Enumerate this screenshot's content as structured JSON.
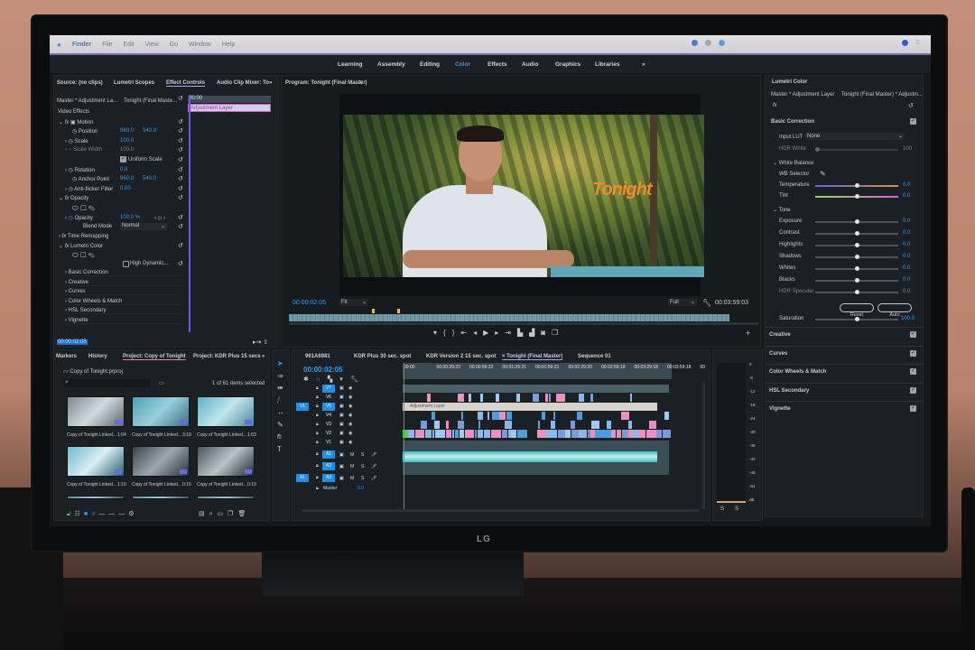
{
  "monitor_brand": "LG",
  "menubar": {
    "items": [
      "Finder",
      "File",
      "Edit",
      "View",
      "Go",
      "Window",
      "Help"
    ]
  },
  "workspaces": {
    "items": [
      "Learning",
      "Assembly",
      "Editing",
      "Color",
      "Effects",
      "Audio",
      "Graphics",
      "Libraries"
    ],
    "active": "Color",
    "more": "»",
    "accent": "#2d9bf0"
  },
  "left_panel": {
    "tabs": [
      "Source: (no clips)",
      "Lumetri Scopes",
      "Effect Controls",
      "Audio Clip Mixer: To"
    ],
    "active_tab": "Effect Controls",
    "more": "»",
    "master_clip": "Master * Adjustment La...",
    "sequence_clip": "Tonight (Final Maste...",
    "ruler_start": "00:00",
    "clip_label": "Adjustment Layer",
    "section": "Video Effects",
    "motion": {
      "label": "Motion",
      "position_label": "Position",
      "position_x": "960.0",
      "position_y": "540.0",
      "scale_label": "Scale",
      "scale": "100.0",
      "scale_width_label": "Scale Width",
      "scale_width": "100.0",
      "uniform_scale": "Uniform Scale",
      "rotation_label": "Rotation",
      "rotation": "0.0",
      "anchor_label": "Anchor Point",
      "anchor_x": "960.0",
      "anchor_y": "540.0",
      "antiflicker_label": "Anti-flicker Filter",
      "antiflicker": "0.00"
    },
    "opacity": {
      "label": "Opacity",
      "opacity_label": "Opacity",
      "value": "100.0 %",
      "blend_label": "Blend Mode",
      "blend": "Normal"
    },
    "time_remapping": "Time Remapping",
    "lumetri": {
      "label": "Lumetri Color",
      "hdr": "High Dynamic...",
      "sections": [
        "Basic Correction",
        "Creative",
        "Curves",
        "Color Wheels & Match",
        "HSL Secondary",
        "Vignette"
      ]
    },
    "timecode": "00:00:02:05"
  },
  "program": {
    "title": "Program: Tonight (Final Master)",
    "overlay_text": "Tonight",
    "timecode": "00:00:02:05",
    "fit": "Fit",
    "quality": "Full",
    "duration": "00:03:59:03"
  },
  "lumetri_panel": {
    "title": "Lumetri Color",
    "master": "Master * Adjustment Layer",
    "sequence": "Tonight (Final Master) * Adjustm...",
    "basic_correction": "Basic Correction",
    "input_lut_label": "Input LUT",
    "input_lut": "None",
    "hdr_white_label": "HDR White",
    "hdr_white": "100",
    "white_balance": "White Balance",
    "wb_selector": "WB Selector",
    "tone": "Tone",
    "sliders": [
      {
        "label": "Temperature",
        "value": "0.0",
        "level": 0.5,
        "group": "wb"
      },
      {
        "label": "Tint",
        "value": "0.0",
        "level": 0.5,
        "group": "wb"
      },
      {
        "label": "Exposure",
        "value": "0.0",
        "level": 0.5,
        "group": "tone"
      },
      {
        "label": "Contrast",
        "value": "0.0",
        "level": 0.5,
        "group": "tone"
      },
      {
        "label": "Highlights",
        "value": "0.0",
        "level": 0.5,
        "group": "tone"
      },
      {
        "label": "Shadows",
        "value": "0.0",
        "level": 0.5,
        "group": "tone"
      },
      {
        "label": "Whites",
        "value": "0.0",
        "level": 0.5,
        "group": "tone"
      },
      {
        "label": "Blacks",
        "value": "0.0",
        "level": 0.5,
        "group": "tone"
      },
      {
        "label": "HDR Specular",
        "value": "0.0",
        "level": 0.5,
        "group": "tone"
      }
    ],
    "reset": "Reset",
    "auto": "Auto",
    "saturation_label": "Saturation",
    "saturation": "100.0",
    "sections": [
      "Creative",
      "Curves",
      "Color Wheels & Match",
      "HSL Secondary",
      "Vignette"
    ]
  },
  "project_panel": {
    "tabs": [
      "Markers",
      "History",
      "Project: Copy of Tonight",
      "Project: KDR Plus 15 secs"
    ],
    "active_tab": "Project: Copy of Tonight",
    "more": "»",
    "file": "Copy of Tonight.prproj",
    "selection": "1 of 61 items selected",
    "items": [
      {
        "name": "Copy of Tonight Linked...",
        "duration": "1:04"
      },
      {
        "name": "Copy of Tonight Linked...",
        "duration": "3:19"
      },
      {
        "name": "Copy of Tonight Linked...",
        "duration": "1:03"
      },
      {
        "name": "Copy of Tonight Linked...",
        "duration": "1:10"
      },
      {
        "name": "Copy of Tonight Linked...",
        "duration": "0:16"
      },
      {
        "name": "Copy of Tonight Linked...",
        "duration": "0:19"
      }
    ]
  },
  "timeline": {
    "tabs": [
      "961A6981",
      "KDR Plus 30 sec. spot",
      "KDR Version 2 15 sec. spot",
      "Tonight (Final Master)",
      "Sequence 01"
    ],
    "active_tab": "Tonight (Final Master)",
    "timecode": "00:00:02:05",
    "ruler": [
      "00:00",
      "00:00:29:23",
      "00:00:59:22",
      "00:01:29:21",
      "00:01:59:21",
      "00:02:29:20",
      "00:02:59:19",
      "00:03:29:18",
      "00:03:59:18",
      "00"
    ],
    "video_tracks": [
      "V7",
      "V6",
      "V5",
      "V4",
      "V3",
      "V2",
      "V1"
    ],
    "audio_tracks": [
      "A1",
      "A2",
      "A3"
    ],
    "source_v": "V1",
    "source_a": "A1",
    "adjustment_clip": "Adjustment Layer",
    "master_label": "Master",
    "master_value": "0.0",
    "meter_scale": [
      "0",
      "-6",
      "-12",
      "-18",
      "-24",
      "-30",
      "-36",
      "-42",
      "-48",
      "-54",
      "dB"
    ],
    "meter_solo": [
      "S",
      "S"
    ]
  }
}
